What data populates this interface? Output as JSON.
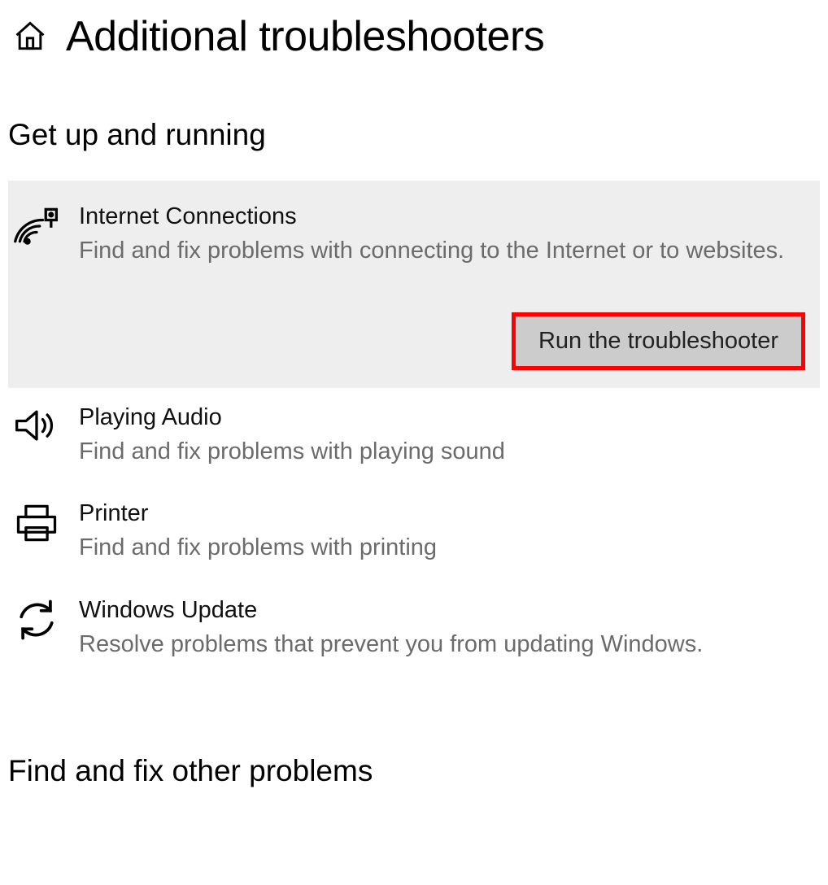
{
  "header": {
    "title": "Additional troubleshooters"
  },
  "sections": {
    "get_up_running": "Get up and running",
    "find_fix_other": "Find and fix other problems"
  },
  "troubleshooters": [
    {
      "icon": "wifi-network-icon",
      "title": "Internet Connections",
      "desc": "Find and fix problems with connecting to the Internet or to websites.",
      "run_label": "Run the troubleshooter",
      "selected": true
    },
    {
      "icon": "speaker-icon",
      "title": "Playing Audio",
      "desc": "Find and fix problems with playing sound",
      "selected": false
    },
    {
      "icon": "printer-icon",
      "title": "Printer",
      "desc": "Find and fix problems with printing",
      "selected": false
    },
    {
      "icon": "update-icon",
      "title": "Windows Update",
      "desc": "Resolve problems that prevent you from updating Windows.",
      "selected": false
    }
  ]
}
